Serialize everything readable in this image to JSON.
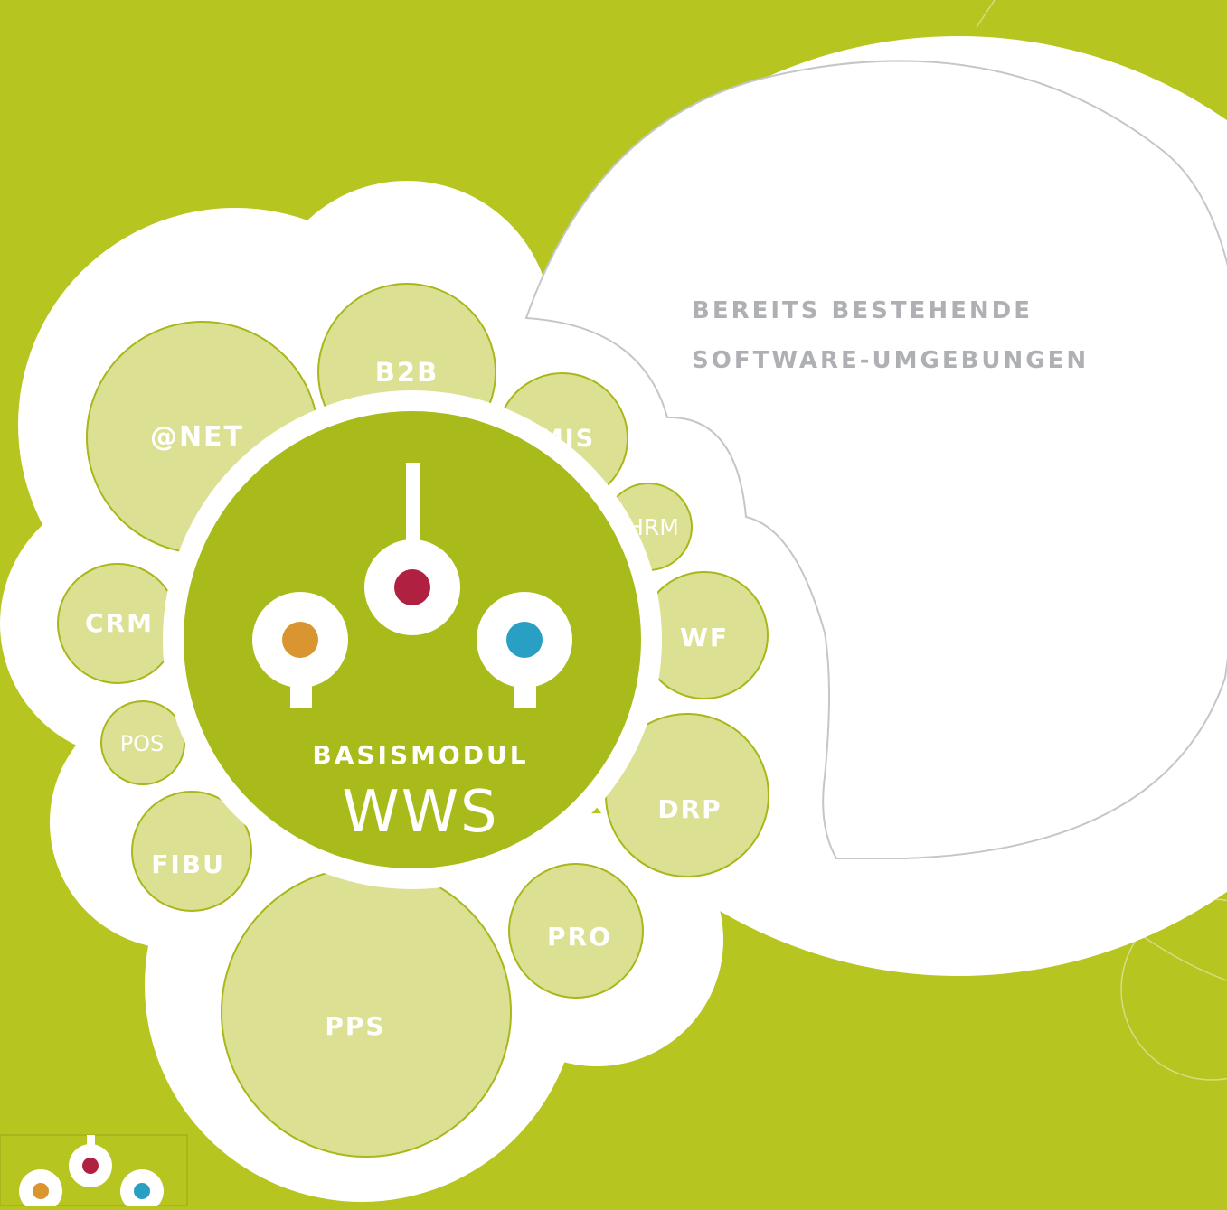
{
  "colors": {
    "background": "#b6c51f",
    "bubble_fill": "#dce093",
    "bubble_stroke": "#a8b71a",
    "center_fill": "#a9bb1b",
    "outline_gray": "#c4c6c8",
    "dot_red": "#b02040",
    "dot_orange": "#d99530",
    "dot_blue": "#2a9fc4",
    "heading_gray": "#aeb0b3"
  },
  "callout": {
    "line1": "BEREITS BESTEHENDE",
    "line2": "SOFTWARE-UMGEBUNGEN"
  },
  "center": {
    "subtitle": "BASISMODUL",
    "title": "WWS"
  },
  "modules": {
    "net": "@NET",
    "b2b": "B2B",
    "mis": "MIS",
    "hrm": "HRM",
    "wf": "WF",
    "drp": "DRP",
    "pro": "PRO",
    "pps": "PPS",
    "fibu": "FIBU",
    "pos": "POS",
    "crm": "CRM"
  },
  "icons": {
    "center_connectors": "three-connector-plugs-icon",
    "logo": "three-dots-logo-icon"
  }
}
